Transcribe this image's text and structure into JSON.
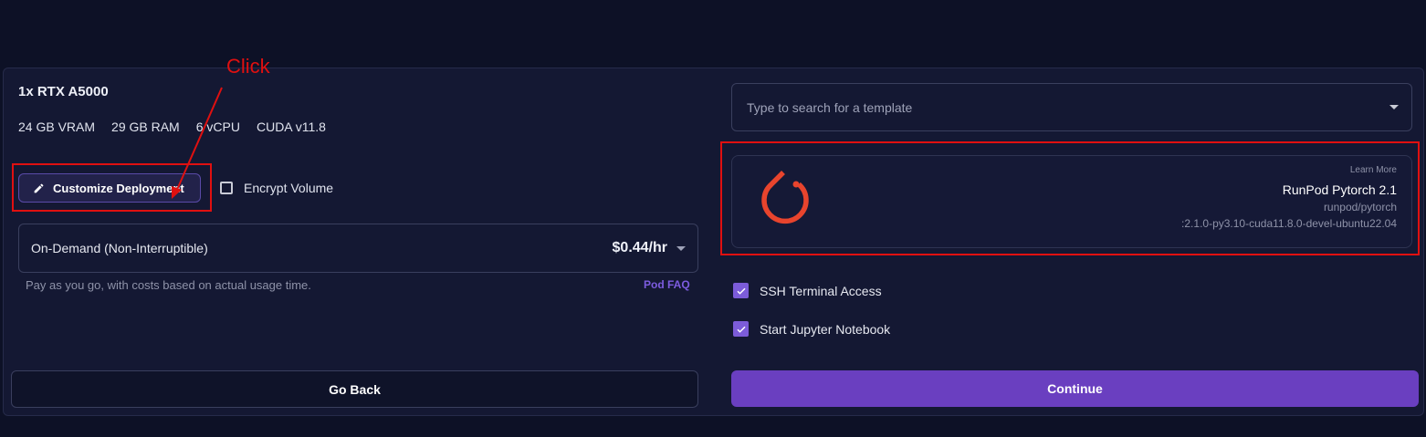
{
  "gpu": {
    "title": "1x RTX A5000",
    "specs": [
      "24 GB VRAM",
      "29 GB RAM",
      "6 vCPU",
      "CUDA v11.8"
    ]
  },
  "actions": {
    "customize_label": "Customize Deployment",
    "encrypt_label": "Encrypt Volume",
    "go_back_label": "Go Back",
    "continue_label": "Continue"
  },
  "pricing": {
    "selected": "On-Demand (Non-Interruptible)",
    "price": "$0.44/hr",
    "description": "Pay as you go, with costs based on actual usage time.",
    "faq_link": "Pod FAQ"
  },
  "template": {
    "search_placeholder": "Type to search for a template",
    "learn_more": "Learn More",
    "name": "RunPod Pytorch 2.1",
    "image": "runpod/pytorch",
    "tag": ":2.1.0-py3.10-cuda11.8.0-devel-ubuntu22.04",
    "logo_icon": "pytorch-logo"
  },
  "options": [
    {
      "label": "SSH Terminal Access",
      "checked": true
    },
    {
      "label": "Start Jupyter Notebook",
      "checked": true
    }
  ],
  "annotation": {
    "text": "Click",
    "color": "#e01010"
  },
  "colors": {
    "background": "#0d1126",
    "panel": "#141833",
    "accent": "#6a3fc0",
    "checkbox": "#7c5cd9",
    "pytorch": "#e8442d"
  }
}
